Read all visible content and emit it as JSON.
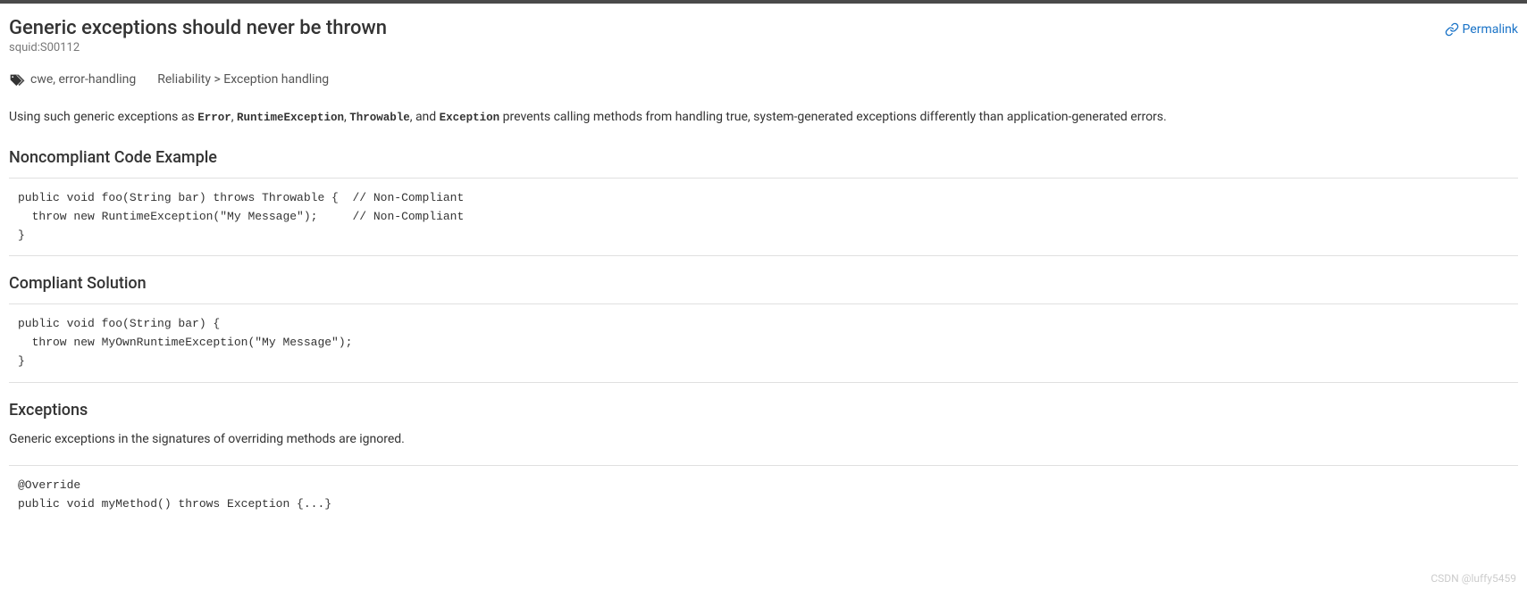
{
  "header": {
    "title": "Generic exceptions should never be thrown",
    "rule_key": "squid:S00112",
    "permalink_label": "Permalink"
  },
  "meta": {
    "tags_text": "cwe, error-handling",
    "breadcrumb": "Reliability > Exception handling"
  },
  "description": {
    "prefix": "Using such generic exceptions as ",
    "code1": "Error",
    "sep1": ", ",
    "code2": "RuntimeException",
    "sep2": ", ",
    "code3": "Throwable",
    "sep3": ", and ",
    "code4": "Exception",
    "suffix": " prevents calling methods from handling true, system-generated exceptions differently than application-generated errors."
  },
  "sections": {
    "noncompliant": {
      "heading": "Noncompliant Code Example",
      "code": "public void foo(String bar) throws Throwable {  // Non-Compliant\n  throw new RuntimeException(\"My Message\");     // Non-Compliant\n}"
    },
    "compliant": {
      "heading": "Compliant Solution",
      "code": "public void foo(String bar) {\n  throw new MyOwnRuntimeException(\"My Message\");\n}"
    },
    "exceptions": {
      "heading": "Exceptions",
      "desc": "Generic exceptions in the signatures of overriding methods are ignored.",
      "code": "@Override\npublic void myMethod() throws Exception {...}"
    }
  },
  "watermark": "CSDN @luffy5459"
}
